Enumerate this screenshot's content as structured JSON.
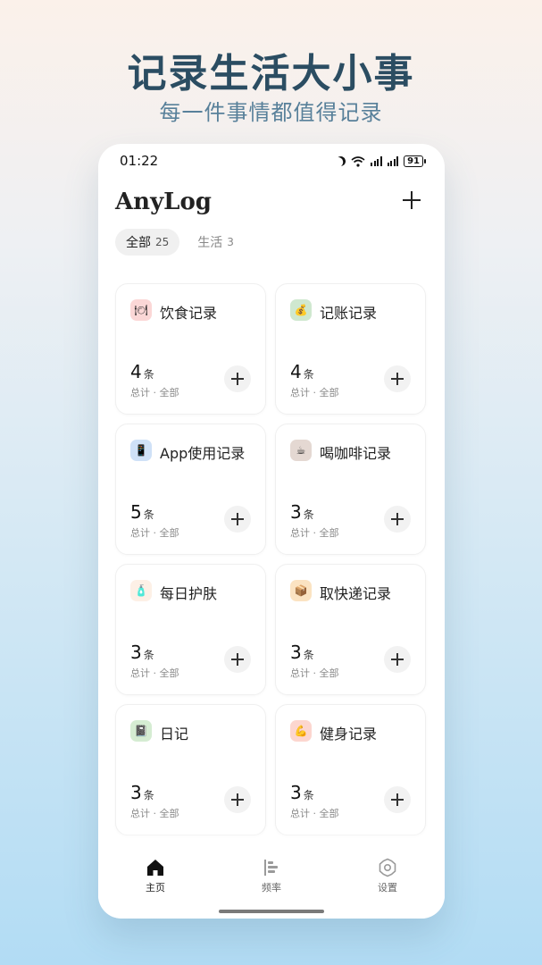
{
  "hero": {
    "title": "记录生活大小事",
    "subtitle": "每一件事情都值得记录"
  },
  "status_bar": {
    "time": "01:22",
    "battery": "91",
    "icons": [
      "moon-icon",
      "wifi-icon",
      "signal-icon",
      "signal-icon",
      "battery-icon"
    ]
  },
  "app": {
    "title": "AnyLog",
    "add_icon": "plus-icon"
  },
  "tabs": [
    {
      "label": "全部",
      "count": "25",
      "active": true
    },
    {
      "label": "生活",
      "count": "3",
      "active": false
    }
  ],
  "cards": [
    {
      "name": "饮食记录",
      "count": "4",
      "unit": "条",
      "meta": "总计 · 全部",
      "icon": "utensils-icon",
      "icon_bg": "#fbd7d6"
    },
    {
      "name": "记账记录",
      "count": "4",
      "unit": "条",
      "meta": "总计 · 全部",
      "icon": "money-bag-icon",
      "icon_bg": "#cfe8cf"
    },
    {
      "name": "App使用记录",
      "count": "5",
      "unit": "条",
      "meta": "总计 · 全部",
      "icon": "phone-icon",
      "icon_bg": "#cfe1f7"
    },
    {
      "name": "喝咖啡记录",
      "count": "3",
      "unit": "条",
      "meta": "总计 · 全部",
      "icon": "coffee-icon",
      "icon_bg": "#e4d8d2"
    },
    {
      "name": "每日护肤",
      "count": "3",
      "unit": "条",
      "meta": "总计 · 全部",
      "icon": "lotion-icon",
      "icon_bg": "#fdf0e6"
    },
    {
      "name": "取快递记录",
      "count": "3",
      "unit": "条",
      "meta": "总计 · 全部",
      "icon": "package-icon",
      "icon_bg": "#fbe3c2"
    },
    {
      "name": "日记",
      "count": "3",
      "unit": "条",
      "meta": "总计 · 全部",
      "icon": "notebook-icon",
      "icon_bg": "#d5ecd2"
    },
    {
      "name": "健身记录",
      "count": "3",
      "unit": "条",
      "meta": "总计 · 全部",
      "icon": "flexed-arm-icon",
      "icon_bg": "#fcd6cf"
    }
  ],
  "nav": [
    {
      "label": "主页",
      "icon": "home-icon",
      "active": true
    },
    {
      "label": "频率",
      "icon": "bar-chart-icon",
      "active": false
    },
    {
      "label": "设置",
      "icon": "gear-icon",
      "active": false
    }
  ]
}
